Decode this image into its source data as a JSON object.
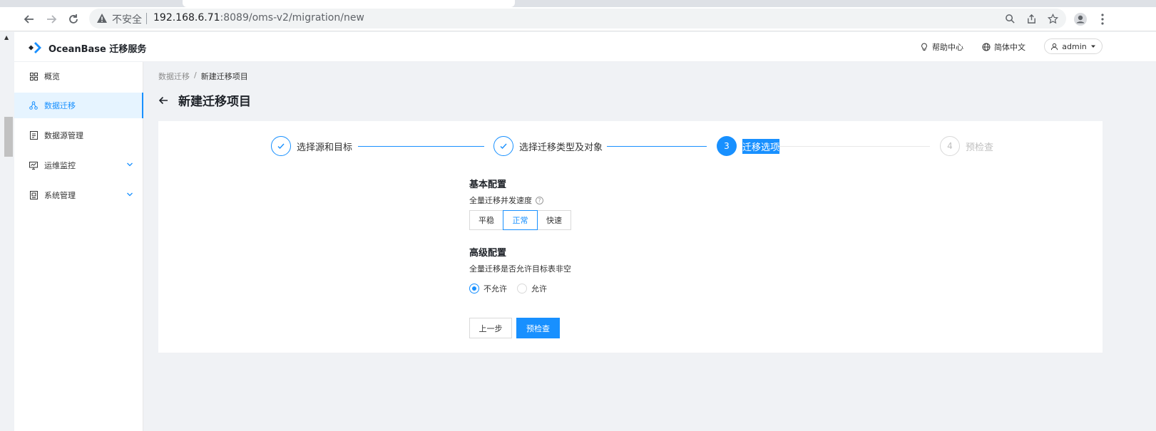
{
  "browser": {
    "insecure_label": "不安全",
    "url_host": "192.168.6.71",
    "url_rest": ":8089/oms-v2/migration/new"
  },
  "header": {
    "logo_text": "OceanBase 迁移服务",
    "help_label": "帮助中心",
    "language_label": "简体中文",
    "user_label": "admin"
  },
  "sidebar": {
    "items": [
      {
        "label": "概览",
        "icon": "grid-icon",
        "active": false
      },
      {
        "label": "数据迁移",
        "icon": "migration-icon",
        "active": true
      },
      {
        "label": "数据源管理",
        "icon": "datasource-icon",
        "active": false
      },
      {
        "label": "运维监控",
        "icon": "monitor-icon",
        "active": false,
        "expandable": true
      },
      {
        "label": "系统管理",
        "icon": "system-icon",
        "active": false,
        "expandable": true
      }
    ]
  },
  "breadcrumb": {
    "parent": "数据迁移",
    "separator": "/",
    "current": "新建迁移项目"
  },
  "page": {
    "title": "新建迁移项目"
  },
  "steps": [
    {
      "number": "1",
      "label": "选择源和目标",
      "status": "done"
    },
    {
      "number": "2",
      "label": "选择迁移类型及对象",
      "status": "done"
    },
    {
      "number": "3",
      "label": "迁移选项",
      "status": "active"
    },
    {
      "number": "4",
      "label": "预检查",
      "status": "wait"
    }
  ],
  "form": {
    "basic_title": "基本配置",
    "speed_label": "全量迁移并发速度",
    "speed_options": [
      "平稳",
      "正常",
      "快速"
    ],
    "speed_selected": "正常",
    "advanced_title": "高级配置",
    "nonempty_label": "全量迁移是否允许目标表非空",
    "nonempty_options": [
      "不允许",
      "允许"
    ],
    "nonempty_selected": "不允许",
    "prev_button": "上一步",
    "next_button": "预检查"
  },
  "colors": {
    "accent": "#1890ff",
    "active_bg": "#e6f4ff"
  }
}
